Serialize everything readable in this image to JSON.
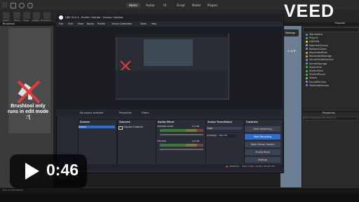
{
  "studio": {
    "menu_tabs": [
      "Home",
      "Avatar",
      "UI",
      "Script",
      "Model",
      "Plugins"
    ],
    "ribbon_buttons": [
      "Select",
      "Move",
      "Scale",
      "Rotate",
      "Transform"
    ],
    "left_tab": "Brushtool",
    "left_message": "Brushtool only runs in edit mode :'("
  },
  "explorer": {
    "title": "Explorer",
    "items": [
      "Workspace",
      "Players",
      "Lighting",
      "MaterialService",
      "NetworkClient",
      "ReplicatedFirst",
      "ReplicatedStorage",
      "ServerScriptService",
      "ServerStorage",
      "StarterGui",
      "StarterPack",
      "StarterPlayer",
      "Teams",
      "SoundService",
      "TextChatService"
    ],
    "icon_colors": [
      "#4c8bd6",
      "#4caf50",
      "#f0c040",
      "#9e9e9e",
      "#6a8fd8",
      "#d0a050",
      "#d0a050",
      "#6a8fd8",
      "#6a8fd8",
      "#4caf50",
      "#4caf50",
      "#4caf50",
      "#9e9e9e",
      "#b070d0",
      "#4c8bd6"
    ]
  },
  "properties": {
    "title": "Properties",
    "filter_placeholder": "Filter Properties (Ctrl+Shift+P)"
  },
  "command_bar": {
    "placeholder": "Run a command"
  },
  "obs": {
    "title": "OBS 30.0.4 - Profile: Untitled - Scenes: Untitled",
    "menu": [
      "File",
      "Edit",
      "View",
      "Docks",
      "Profile",
      "Scene Collection",
      "Tools",
      "Help"
    ],
    "no_source": "No source selected",
    "properties_btn": "Properties",
    "filters_btn": "Filters",
    "docks": {
      "scenes": {
        "title": "Scenes",
        "items": [
          "Scene"
        ]
      },
      "sources": {
        "title": "Sources",
        "items": [
          "Display Capture"
        ]
      },
      "mixer": {
        "title": "Audio Mixer",
        "channels": [
          "Desktop Audio",
          "Mic/Aux"
        ],
        "levels": [
          "0.0 dB",
          "0.0 dB"
        ]
      },
      "transitions": {
        "title": "Scene Transitions",
        "transition": "Fade",
        "duration_label": "Duration",
        "duration": "300 ms"
      },
      "controls": {
        "title": "Controls",
        "buttons": [
          "Start Streaming",
          "Start Recording",
          "Start Virtual Camera",
          "Studio Mode",
          "Settings",
          "Exit"
        ]
      }
    },
    "status": {
      "rec_time": "00:00:00",
      "cpu": "CPU: 1.0%, 30.00 / 30.00 FPS"
    }
  },
  "right_viewport": {
    "settings": "Settings",
    "value": "2,374"
  },
  "overlay": {
    "time": "0:46",
    "brand": "VEED"
  },
  "colors": {
    "accent_blue": "#2a6ecf",
    "obs_bg": "#272a33",
    "studio_bg": "#2b2b2b"
  }
}
